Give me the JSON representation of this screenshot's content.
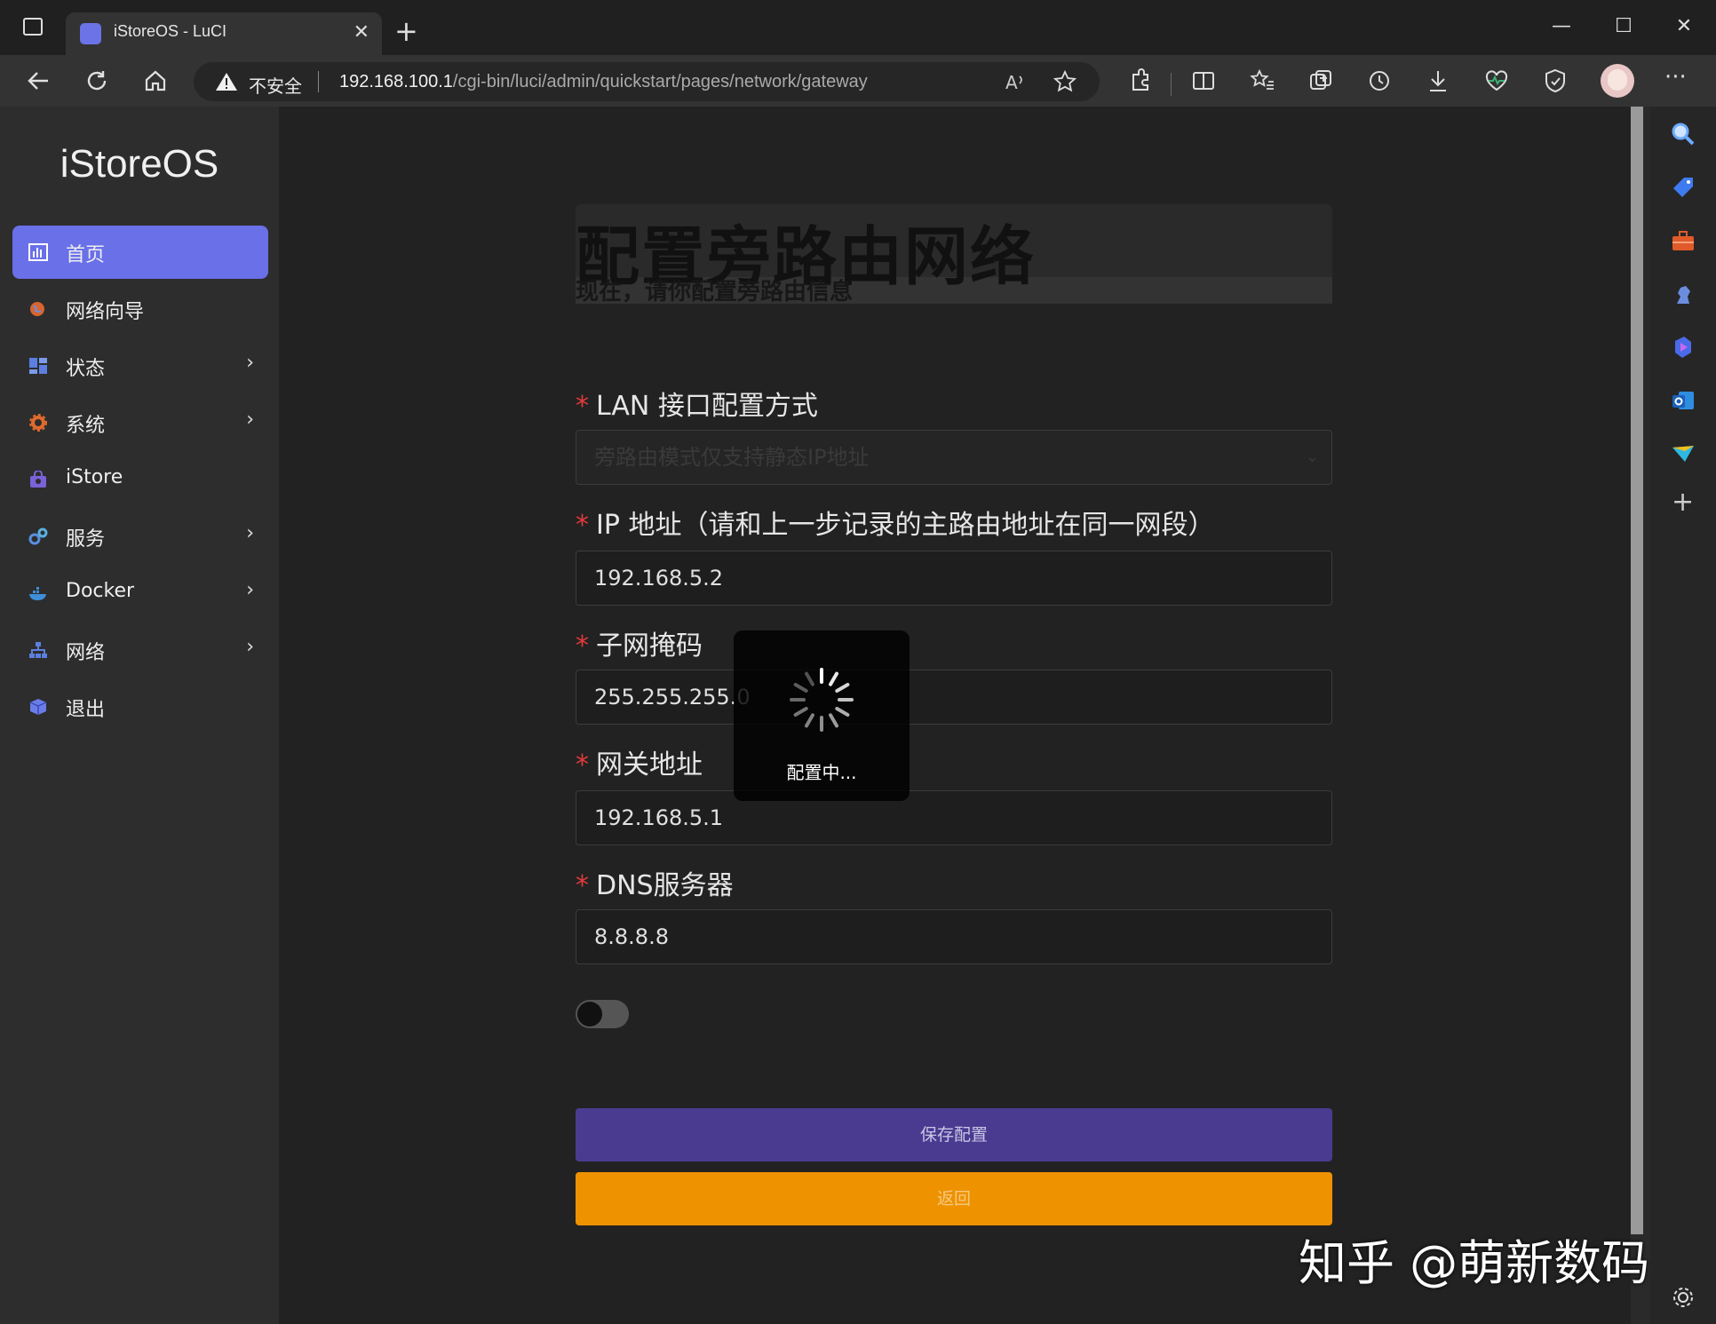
{
  "browser": {
    "tab_title": "iStoreOS - LuCI",
    "address": {
      "security_label": "不安全",
      "url_host": "192.168.100.1",
      "url_path": "/cgi-bin/luci/admin/quickstart/pages/network/gateway"
    }
  },
  "sidebar": {
    "brand": "iStoreOS",
    "items": [
      {
        "label": "首页",
        "icon": "dashboard-icon",
        "active": true
      },
      {
        "label": "网络向导",
        "icon": "globe-icon"
      },
      {
        "label": "状态",
        "icon": "grid-icon",
        "chevron": true
      },
      {
        "label": "系统",
        "icon": "gear-icon",
        "chevron": true
      },
      {
        "label": "iStore",
        "icon": "bag-icon"
      },
      {
        "label": "服务",
        "icon": "services-icon",
        "chevron": true
      },
      {
        "label": "Docker",
        "icon": "docker-icon",
        "chevron": true
      },
      {
        "label": "网络",
        "icon": "network-icon",
        "chevron": true
      },
      {
        "label": "退出",
        "icon": "logout-icon"
      }
    ]
  },
  "main": {
    "heading": "配置旁路由网络",
    "subheading": "现在，请你配置旁路由信息",
    "fields": {
      "lan_mode": {
        "label": "LAN 接口配置方式",
        "value": "旁路由模式仅支持静态IP地址"
      },
      "ip": {
        "label": "IP 地址（请和上一步记录的主路由地址在同一网段）",
        "value": "192.168.5.2"
      },
      "netmask": {
        "label": "子网掩码",
        "value": "255.255.255.0"
      },
      "gateway": {
        "label": "网关地址",
        "value": "192.168.5.1"
      },
      "dns": {
        "label": "DNS服务器",
        "value": "8.8.8.8"
      }
    },
    "required_mark": "*",
    "toggle_on": false,
    "save_label": "保存配置",
    "back_label": "返回",
    "loading_text": "配置中..."
  },
  "watermark": "知乎 @萌新数码",
  "colors": {
    "accent": "#6a70e8",
    "save": "#4a3b91",
    "back": "#ee9200",
    "required": "#e23b3b"
  }
}
